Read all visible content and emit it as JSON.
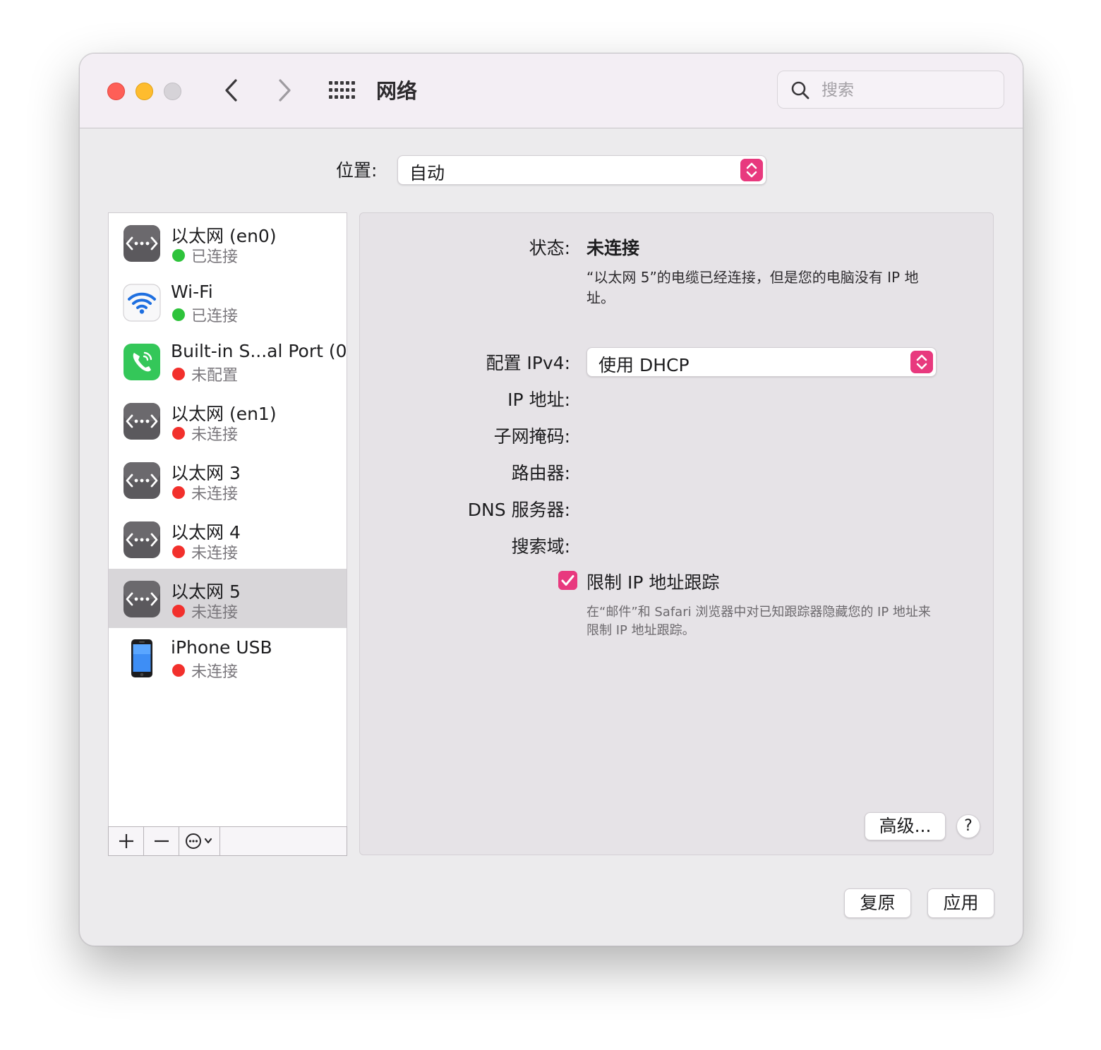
{
  "window": {
    "title": "网络",
    "search_placeholder": "搜索"
  },
  "location": {
    "label": "位置:",
    "value": "自动"
  },
  "services": [
    {
      "name": "以太网 (en0)",
      "status": "已连接",
      "status_color": "#2ec33b",
      "icon": "ethernet-icon"
    },
    {
      "name": "Wi-Fi",
      "status": "已连接",
      "status_color": "#2ec33b",
      "icon": "wifi-icon"
    },
    {
      "name": "Built-in S...al Port (0)",
      "status": "未配置",
      "status_color": "#f2302c",
      "icon": "phone-modem-icon"
    },
    {
      "name": "以太网 (en1)",
      "status": "未连接",
      "status_color": "#f2302c",
      "icon": "ethernet-icon"
    },
    {
      "name": "以太网 3",
      "status": "未连接",
      "status_color": "#f2302c",
      "icon": "ethernet-icon"
    },
    {
      "name": "以太网 4",
      "status": "未连接",
      "status_color": "#f2302c",
      "icon": "ethernet-icon"
    },
    {
      "name": "以太网 5",
      "status": "未连接",
      "status_color": "#f2302c",
      "icon": "ethernet-icon",
      "selected": true
    },
    {
      "name": "iPhone USB",
      "status": "未连接",
      "status_color": "#f2302c",
      "icon": "iphone-icon"
    }
  ],
  "toolbar": {
    "add": "+",
    "remove": "—",
    "action": "⋯"
  },
  "detail": {
    "state_label": "状态:",
    "state_value": "未连接",
    "state_desc": "“以太网 5”的电缆已经连接，但是您的电脑没有 IP 地址。",
    "ipv4_label": "配置 IPv4:",
    "ipv4_value": "使用 DHCP",
    "ip_label": "IP 地址:",
    "subnet_label": "子网掩码:",
    "router_label": "路由器:",
    "dns_label": "DNS 服务器:",
    "search_domain_label": "搜索域:",
    "limit_tracking_label": "限制 IP 地址跟踪",
    "limit_tracking_checked": true,
    "limit_tracking_desc": "在“邮件”和 Safari 浏览器中对已知跟踪器隐藏您的 IP 地址来限制 IP 地址跟踪。",
    "advanced_button": "高级...",
    "help_button": "?"
  },
  "footer": {
    "revert": "复原",
    "apply": "应用"
  },
  "colors": {
    "accent": "#e8397e",
    "connected": "#2ec33b",
    "disconnected": "#f2302c"
  }
}
